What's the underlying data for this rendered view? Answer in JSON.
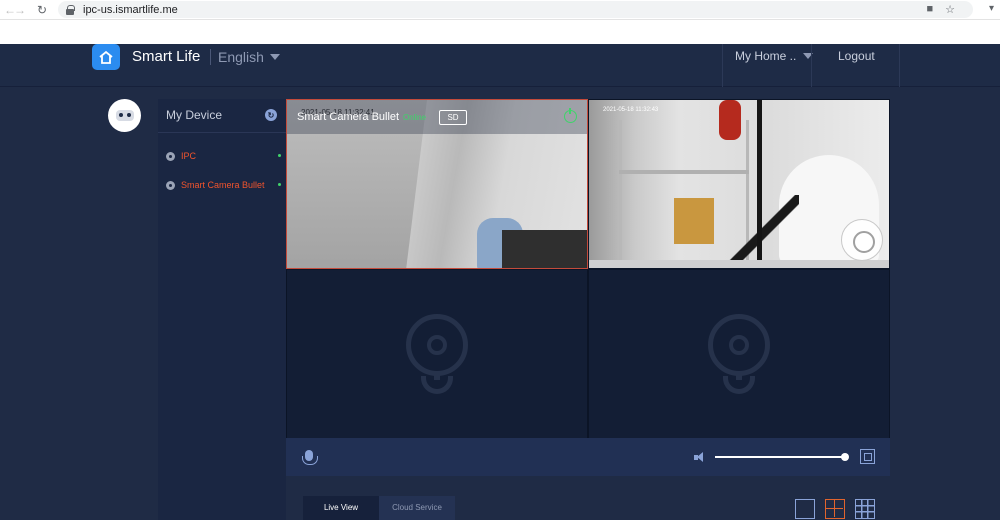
{
  "browser": {
    "url": "ipc-us.ismartlife.me",
    "back_icon": "arrow-left-icon",
    "forward_icon": "arrow-right-icon",
    "reload_icon": "reload-icon"
  },
  "header": {
    "app_name": "Smart Life",
    "language": "English",
    "home_menu": "My Home ..",
    "logout": "Logout"
  },
  "device_panel": {
    "title": "My Device",
    "devices": [
      {
        "name": "IPC",
        "status": "online"
      },
      {
        "name": "Smart Camera Bullet",
        "status": "online"
      }
    ]
  },
  "video_grid": {
    "cells": [
      {
        "title": "Smart Camera Bullet",
        "status": "Online",
        "quality": "SD",
        "timestamp": "2021-05-18 11:32:41"
      },
      {
        "timestamp": "2021-05-18 11:32:43"
      },
      {
        "empty": true
      },
      {
        "empty": true
      }
    ]
  },
  "controls": {
    "volume_percent": 100
  },
  "tabs": [
    {
      "label": "Live View",
      "active": true
    },
    {
      "label": "Cloud Service",
      "active": false
    }
  ],
  "colors": {
    "accent_orange": "#e0642e",
    "online_green": "#3fd46a",
    "brand_blue": "#2b8cf0",
    "background": "#1f2b45"
  }
}
